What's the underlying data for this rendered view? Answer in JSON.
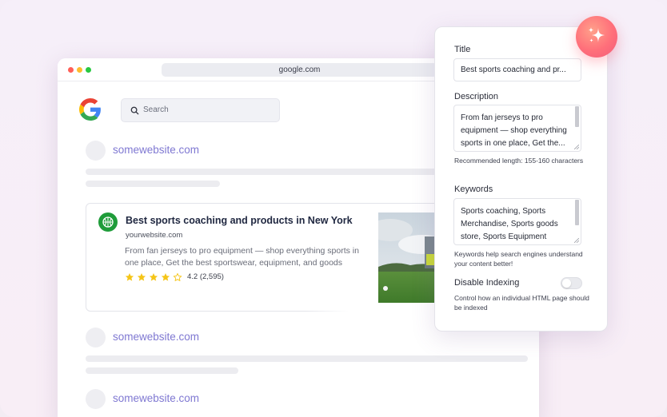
{
  "browser": {
    "url": "google.com",
    "search_placeholder": "Search"
  },
  "results": [
    {
      "site": "somewebsite.com"
    },
    {
      "site": "somewebsite.com"
    },
    {
      "site": "somewebsite.com"
    }
  ],
  "featured": {
    "title": "Best sports coaching and products in New York",
    "url": "yourwebsite.com",
    "description": "From fan jerseys to pro equipment — shop everything sports in one place,  Get the best sportswear, equipment, and goods",
    "rating_text": "4.2 (2,595)",
    "rating": 4.2,
    "stars_total": 5
  },
  "panel": {
    "title_label": "Title",
    "title_value": "Best sports coaching and pr...",
    "description_label": "Description",
    "description_value": "From fan jerseys to pro equipment — shop everything sports in one place,  Get the...",
    "description_help": "Recommended length: 155-160 characters",
    "keywords_label": "Keywords",
    "keywords_value": "Sports coaching, Sports Merchandise, Sports goods store, Sports Equipment",
    "keywords_help": "Keywords help search engines understand your content better!",
    "indexing_label": "Disable Indexing",
    "indexing_enabled": false,
    "indexing_help": "Control how an individual HTML page should be indexed"
  },
  "icons": {
    "logo": "google-g-icon",
    "search": "search-icon",
    "sparkle": "sparkle-icon",
    "star": "star-icon",
    "basketball": "basketball-icon"
  },
  "colors": {
    "link": "#7f78d2",
    "star": "#f5c518",
    "accent_gradient_start": "#ffa08a",
    "accent_gradient_end": "#f25c7a",
    "brand_green": "#1f9c3a"
  }
}
